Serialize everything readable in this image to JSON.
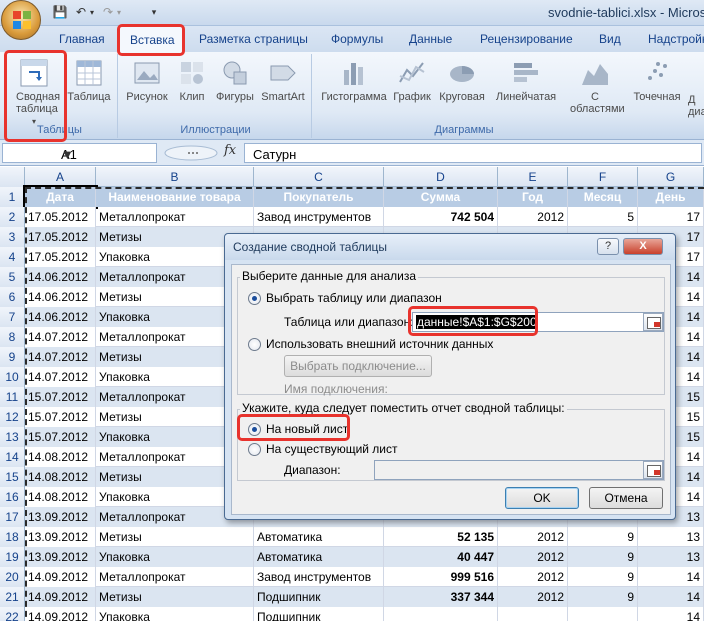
{
  "window": {
    "document_title": "svodnie-tablici.xlsx - Microsoft"
  },
  "ribbon": {
    "tabs": [
      "Главная",
      "Вставка",
      "Разметка страницы",
      "Формулы",
      "Данные",
      "Рецензирование",
      "Вид",
      "Надстройки"
    ],
    "active_tab": "Вставка",
    "groups": {
      "tables": {
        "label": "Таблицы",
        "pivot": "Сводная таблица",
        "table": "Таблица"
      },
      "illustrations": {
        "label": "Иллюстрации",
        "picture": "Рисунок",
        "clip": "Клип",
        "shapes": "Фигуры",
        "smartart": "SmartArt"
      },
      "charts": {
        "label": "Диаграммы",
        "column": "Гистограмма",
        "line": "График",
        "pie": "Круговая",
        "bar": "Линейчатая",
        "area": "С областями",
        "scatter": "Точечная",
        "other": "Д диа"
      }
    }
  },
  "formula_bar": {
    "name_box": "A1",
    "fx": "fx",
    "value": "Сатурн"
  },
  "sheet": {
    "columns": [
      "A",
      "B",
      "C",
      "D",
      "E",
      "F",
      "G"
    ],
    "header_row": [
      "Дата",
      "Наименование товара",
      "Покупатель",
      "Сумма",
      "Год",
      "Месяц",
      "День"
    ],
    "rows": [
      [
        "17.05.2012",
        "Металлопрокат",
        "Завод инструментов",
        "742 504",
        "2012",
        "5",
        "17"
      ],
      [
        "17.05.2012",
        "Метизы",
        "",
        "",
        "",
        "",
        "17"
      ],
      [
        "17.05.2012",
        "Упаковка",
        "",
        "",
        "",
        "",
        "17"
      ],
      [
        "14.06.2012",
        "Металлопрокат",
        "",
        "",
        "",
        "",
        "14"
      ],
      [
        "14.06.2012",
        "Метизы",
        "",
        "",
        "",
        "",
        "14"
      ],
      [
        "14.06.2012",
        "Упаковка",
        "",
        "",
        "",
        "",
        "14"
      ],
      [
        "14.07.2012",
        "Металлопрокат",
        "",
        "",
        "",
        "",
        "14"
      ],
      [
        "14.07.2012",
        "Метизы",
        "",
        "",
        "",
        "",
        "14"
      ],
      [
        "14.07.2012",
        "Упаковка",
        "",
        "",
        "",
        "",
        "14"
      ],
      [
        "15.07.2012",
        "Металлопрокат",
        "",
        "",
        "",
        "",
        "15"
      ],
      [
        "15.07.2012",
        "Метизы",
        "",
        "",
        "",
        "",
        "15"
      ],
      [
        "15.07.2012",
        "Упаковка",
        "",
        "",
        "",
        "",
        "15"
      ],
      [
        "14.08.2012",
        "Металлопрокат",
        "",
        "",
        "",
        "",
        "14"
      ],
      [
        "14.08.2012",
        "Метизы",
        "",
        "",
        "",
        "",
        "14"
      ],
      [
        "14.08.2012",
        "Упаковка",
        "",
        "",
        "",
        "",
        "14"
      ],
      [
        "13.09.2012",
        "Металлопрокат",
        "",
        "",
        "",
        "",
        "13"
      ],
      [
        "13.09.2012",
        "Метизы",
        "Автоматика",
        "52 135",
        "2012",
        "9",
        "13"
      ],
      [
        "13.09.2012",
        "Упаковка",
        "Автоматика",
        "40 447",
        "2012",
        "9",
        "13"
      ],
      [
        "14.09.2012",
        "Металлопрокат",
        "Завод инструментов",
        "999 516",
        "2012",
        "9",
        "14"
      ],
      [
        "14.09.2012",
        "Метизы",
        "Подшипник",
        "337 344",
        "2012",
        "9",
        "14"
      ],
      [
        "14.09.2012",
        "Упаковка",
        "Подшипник",
        "",
        "",
        "",
        "14"
      ]
    ]
  },
  "dialog": {
    "title": "Создание сводной таблицы",
    "help": "?",
    "close": "X",
    "section1_label": "Выберите данные для анализа",
    "opt_select_table": "Выбрать таблицу или диапазон",
    "table_range_label": "Таблица или диапазон:",
    "table_range_value": "данные!$A$1:$G$200",
    "opt_external": "Использовать внешний источник данных",
    "choose_connection": "Выбрать подключение...",
    "connection_name_label": "Имя подключения:",
    "section2_label": "Укажите, куда следует поместить отчет сводной таблицы:",
    "opt_new_sheet": "На новый лист",
    "opt_existing_sheet": "На существующий лист",
    "range_label": "Диапазон:",
    "ok": "OK",
    "cancel": "Отмена"
  }
}
